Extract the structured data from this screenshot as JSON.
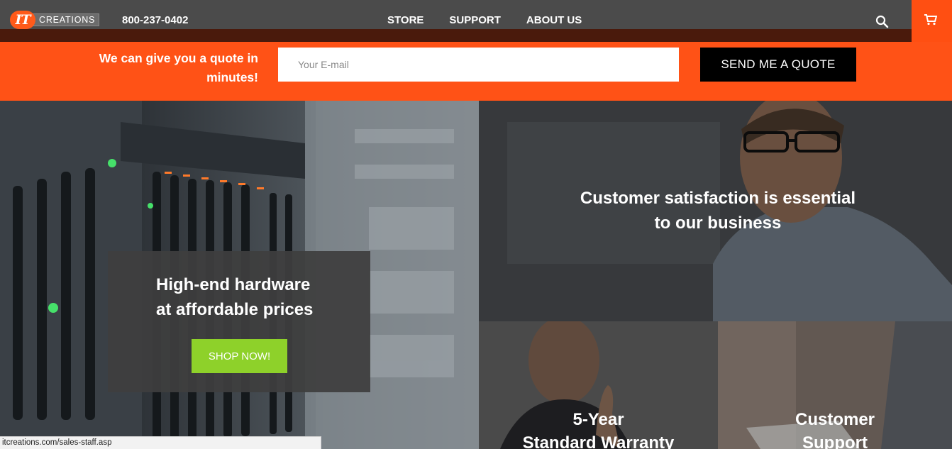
{
  "header": {
    "logo_mark": "IT",
    "logo_word": "CREATIONS",
    "phone": "800-237-0402",
    "nav": [
      "STORE",
      "SUPPORT",
      "ABOUT US"
    ],
    "search_icon": "search-icon",
    "cart_icon": "cart-icon"
  },
  "quote": {
    "line1": "We can give you a quote in",
    "line2": "minutes!",
    "email_placeholder": "Your E-mail",
    "button": "SEND ME A QUOTE"
  },
  "hero": {
    "title_line1": "High-end hardware",
    "title_line2": "at affordable prices",
    "shop_button": "SHOP NOW!"
  },
  "feature": {
    "line1": "Customer satisfaction is essential",
    "line2": "to our business"
  },
  "tiles": [
    {
      "line1": "5-Year",
      "line2": "Standard Warranty"
    },
    {
      "line1": "Customer",
      "line2": "Support"
    }
  ],
  "status_url": "itcreations.com/sales-staff.asp",
  "colors": {
    "accent": "#ff5216",
    "nav_bg": "#4b4b4b",
    "shop_green": "#8ed12a"
  }
}
